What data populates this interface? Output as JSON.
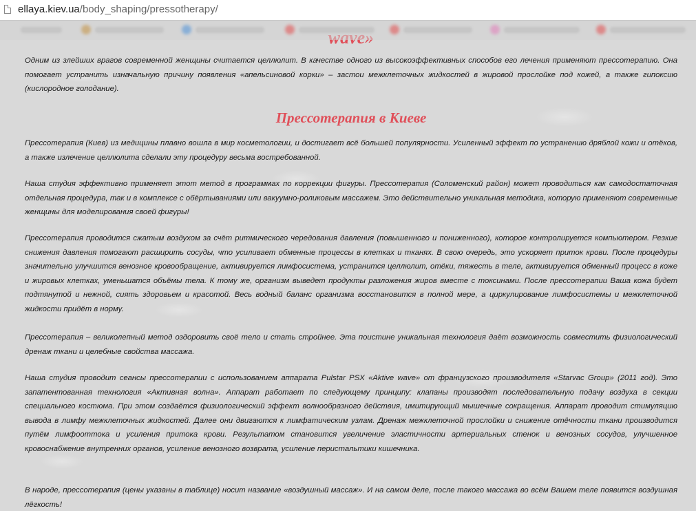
{
  "browser": {
    "url_domain": "ellaya.kiev.ua",
    "url_path": "/body_shaping/pressotherapy/"
  },
  "article": {
    "heading_fragment": "wave»",
    "section_title": "Прессотерапия в Киеве",
    "paragraphs": [
      "Одним из злейших врагов современной женщины считается целлюлит. В качестве одного из высокоэффективных способов его лечения применяют прессотерапию. Она помогает устранить изначальную причину появления «апельсиновой корки» – застои межклеточных жидкостей в жировой прослойке под кожей, а также гипоксию (кислородное голодание).",
      "Прессотерапия (Киев) из медицины плавно вошла в мир косметологии, и достигает всё большей популярности. Усиленный эффект по устранению дряблой кожи и отёков, а также излечение целлюлита сделали эту процедуру весьма востребованной.",
      "Наша студия эффективно применяет этот метод в программах по коррекции фигуры. Прессотерапия (Соломенский район) может проводиться как самодостаточная отдельная процедура, так и в комплексе с обёртываниями или вакуумно-роликовым массажем. Это действительно уникальная методика, которую применяют современные женщины для моделирования своей фигуры!",
      "Прессотерапия проводится сжатым воздухом за счёт ритмического чередования давления (повышенного и пониженного), которое контролируется компьютером. Резкие снижения давления помогают расширить сосуды, что усиливает обменные процессы в клетках и тканях. В свою очередь, это ускоряет приток крови. После процедуры значительно улучшится венозное кровообращение, активируется лимфосистема, устранится целлюлит, отёки, тяжесть в теле, активируется обменный процесс в коже и жировых клетках, уменьшатся объёмы тела. К тому же, организм выведет продукты разложения жиров вместе с токсинами. После прессотерапии Ваша кожа будет подтянутой и нежной, сиять здоровьем и красотой. Весь водный баланс организма восстановится в полной мере, а циркулирование лимфосистемы и межклеточной жидкости придёт в норму.",
      "Прессотерапия – великолепный метод оздоровить своё тело и стать стройнее. Эта поистине уникальная технология даёт возможность совместить физиологический дренаж ткани и целебные свойства массажа.",
      "Наша студия проводит сеансы прессотерапии с использованием аппарата Pulstar PSX «Aktive wave» от французского производителя «Starvac Group» (2011 год). Это запатентованная технология «Активная волна». Аппарат работает по следующему принципу: клапаны производят последовательную подачу воздуха в секции специального костюма. При этом создаётся физиологический эффект волнообразного действия, имитирующий мышечные сокращения. Аппарат проводит стимуляцию вывода в лимфу межклеточных жидкостей. Далее они двигаются к лимфатическим узлам. Дренаж межклеточной прослойки и снижение отёчности ткани производится путём лимфооттока и усиления притока крови. Результатом становится увеличение эластичности артериальных стенок и венозных сосудов, улучшенное кровоснабжение внутренних органов, усиление венозного возврата, усиление перистальтики кишечника.",
      "В народе, прессотерапия (цены указаны в таблице) носит название «воздушный массаж». И на самом деле, после такого массажа во всём Вашем теле появится воздушная лёгкость!"
    ]
  },
  "colors": {
    "heading": "#e0505a",
    "text": "#1a1a1a",
    "background": "#d9d9d9"
  }
}
